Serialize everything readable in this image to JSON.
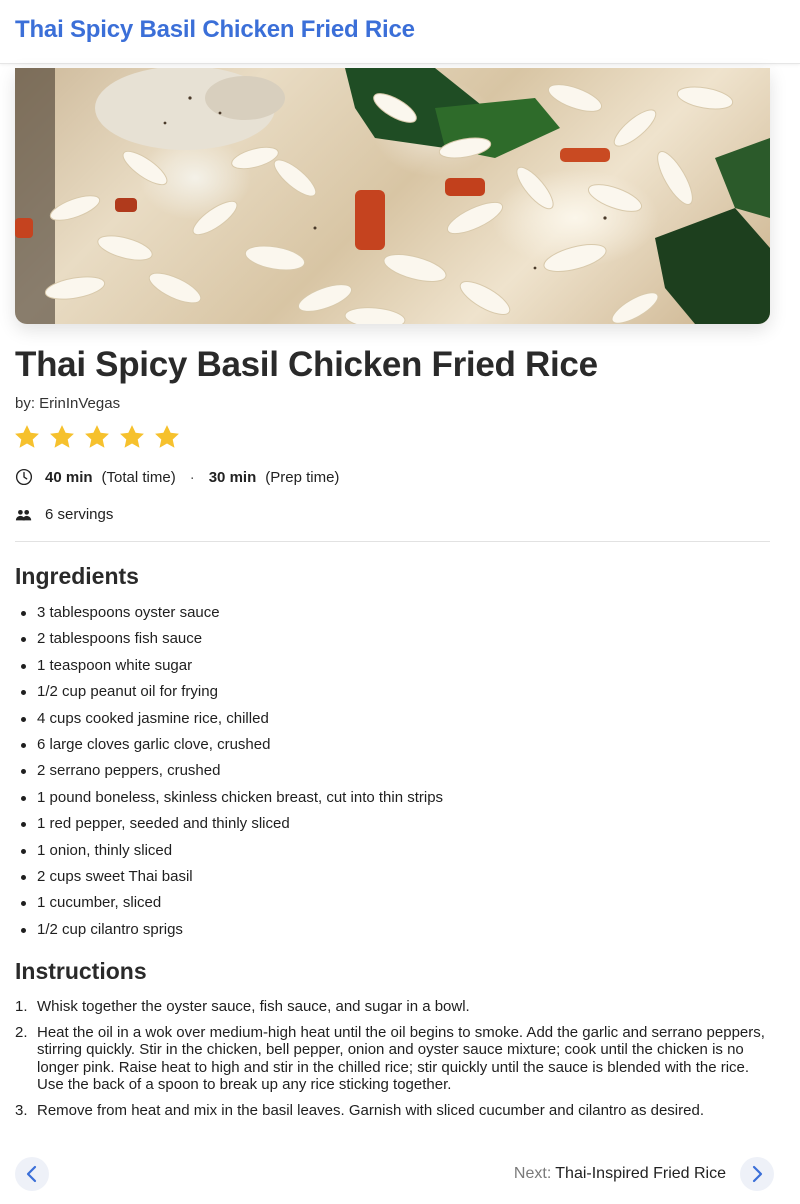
{
  "colors": {
    "accent": "#3b6fd8",
    "star": "#f6c12d",
    "text": "#1f1f1f"
  },
  "header": {
    "title": "Thai Spicy Basil Chicken Fried Rice"
  },
  "recipe": {
    "title": "Thai Spicy Basil Chicken Fried Rice",
    "author": "by: ErinInVegas",
    "rating": 5,
    "rating_max": 5,
    "total_time": "40 min",
    "total_time_label": "(Total time)",
    "time_separator": "·",
    "prep_time": "30 min",
    "prep_time_label": "(Prep time)",
    "servings": "6 servings",
    "icons": {
      "time": "clock-icon",
      "servings": "people-icon",
      "rating": "star-icon"
    }
  },
  "ingredients": {
    "heading": "Ingredients",
    "items": [
      "3 tablespoons oyster sauce",
      "2 tablespoons fish sauce",
      "1 teaspoon white sugar",
      "1/2 cup peanut oil for frying",
      "4 cups cooked jasmine rice, chilled",
      "6 large cloves garlic clove, crushed",
      "2 serrano peppers, crushed",
      "1 pound boneless, skinless chicken breast, cut into thin strips",
      "1 red pepper, seeded and thinly sliced",
      "1 onion, thinly sliced",
      "2 cups sweet Thai basil",
      "1 cucumber, sliced",
      "1/2 cup cilantro sprigs"
    ]
  },
  "instructions": {
    "heading": "Instructions",
    "steps": [
      {
        "num": "1.",
        "text": "Whisk together the oyster sauce, fish sauce, and sugar in a bowl."
      },
      {
        "num": "2.",
        "text": "Heat the oil in a wok over medium-high heat until the oil begins to smoke. Add the garlic and serrano peppers, stirring quickly. Stir in the chicken, bell pepper, onion and oyster sauce mixture; cook until the chicken is no longer pink. Raise heat to high and stir in the chilled rice; stir quickly until the sauce is blended with the rice. Use the back of a spoon to break up any rice sticking together."
      },
      {
        "num": "3.",
        "text": "Remove from heat and mix in the basil leaves. Garnish with sliced cucumber and cilantro as desired."
      }
    ]
  },
  "navigation": {
    "prev_icon": "chevron-left-icon",
    "next_icon": "chevron-right-icon",
    "next_prefix": "Next:",
    "next_title": "Thai-Inspired Fried Rice"
  }
}
